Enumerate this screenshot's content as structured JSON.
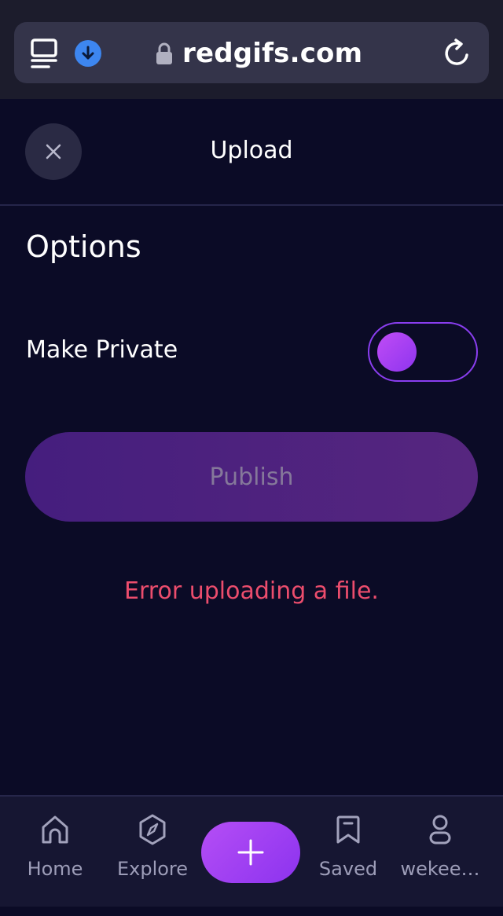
{
  "browser": {
    "url": "redgifs.com",
    "icons": [
      "tabs-icon",
      "download-icon",
      "lock-icon",
      "reload-icon"
    ]
  },
  "header": {
    "title": "Upload",
    "close_icon": "close-icon"
  },
  "options": {
    "section_title": "Options",
    "make_private_label": "Make Private",
    "make_private_enabled": false
  },
  "publish": {
    "label": "Publish",
    "enabled": false
  },
  "error": {
    "message": "Error uploading a file."
  },
  "bottom_nav": {
    "items": [
      {
        "label": "Home",
        "icon": "home-icon"
      },
      {
        "label": "Explore",
        "icon": "compass-icon"
      },
      {
        "label": "Saved",
        "icon": "bookmark-icon"
      },
      {
        "label": "wekee…",
        "icon": "user-icon"
      }
    ],
    "fab_icon": "plus-icon"
  },
  "colors": {
    "background": "#0b0b26",
    "accent": "#9b3ff2",
    "error": "#ec4d6d"
  }
}
